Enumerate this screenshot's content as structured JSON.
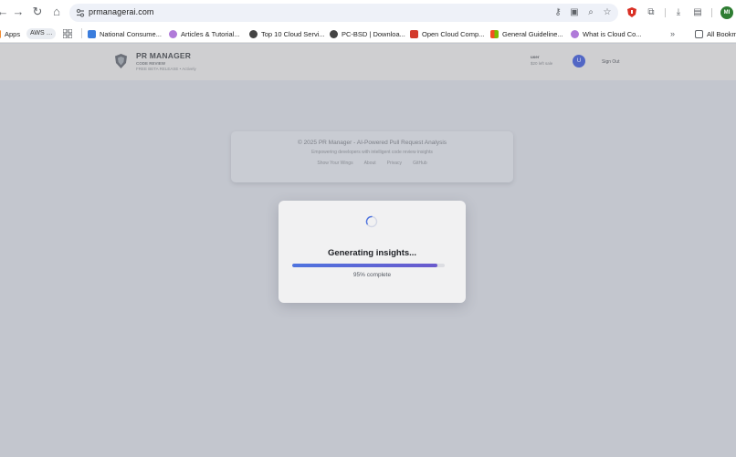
{
  "browser": {
    "url": "prmanagerai.com",
    "profile_initials": "MI",
    "bookmarks": [
      {
        "label": "Apps"
      },
      {
        "label": "AWS"
      },
      {
        "label": "National Consume..."
      },
      {
        "label": "Articles & Tutorial..."
      },
      {
        "label": "Top 10 Cloud Servi..."
      },
      {
        "label": "PC-BSD | Downloa..."
      },
      {
        "label": "Open Cloud Comp..."
      },
      {
        "label": "General Guideline..."
      },
      {
        "label": "What is Cloud Co..."
      }
    ],
    "all_bookmarks_label": "All Bookm"
  },
  "app": {
    "brand_title": "PR MANAGER",
    "brand_subtitle": "CODE REVIEW",
    "brand_tagline": "FREE BETA RELEASE • Actively",
    "user_name": "user",
    "user_meta": "$20 left sale",
    "user_initial": "U",
    "signout_label": "Sign Out"
  },
  "footer": {
    "copyright": "© 2025 PR Manager - AI-Powered Pull Request Analysis",
    "tagline": "Empowering developers with intelligent code review insights",
    "links": [
      "Show Your Wings",
      "About",
      "Privacy",
      "GitHub"
    ]
  },
  "modal": {
    "title": "Generating insights...",
    "progress_percent": 95,
    "progress_label": "95% complete"
  },
  "colors": {
    "accent": "#4e73df",
    "accent_end": "#6a5acd",
    "overlay": "#c3c6ce"
  }
}
